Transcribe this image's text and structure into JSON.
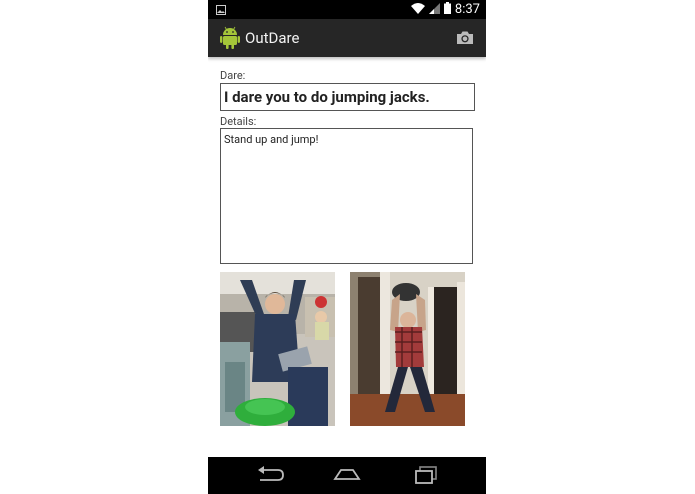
{
  "app": {
    "title": "OutDare"
  },
  "status_bar": {
    "time": "8:37"
  },
  "form": {
    "dare_label": "Dare:",
    "dare_value": "I dare you to do jumping jacks.",
    "details_label": "Details:",
    "details_value": "Stand up and jump!"
  },
  "photos": [
    {
      "name": "photo-man-raising-arms"
    },
    {
      "name": "photo-man-jumping"
    }
  ],
  "icons": [
    "image-icon",
    "wifi-icon",
    "signal-icon",
    "battery-icon",
    "android-logo-icon",
    "camera-icon",
    "back-icon",
    "home-icon",
    "recents-icon"
  ],
  "colors": {
    "action_bar": "#262626",
    "status_bar": "#000000",
    "nav_bar": "#000000"
  }
}
